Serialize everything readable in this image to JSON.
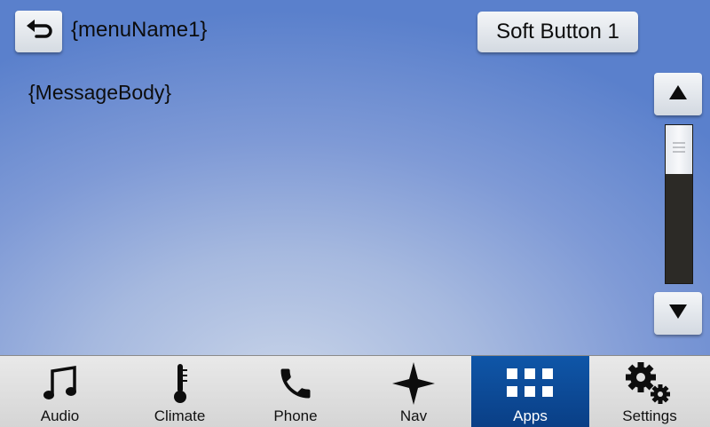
{
  "header": {
    "back_icon": "back-arrow-icon",
    "menu_name": "{menuName1}",
    "soft_button_label": "Soft Button 1"
  },
  "content": {
    "message_body": "{MessageBody}"
  },
  "scrollbar": {
    "up_icon": "triangle-up-icon",
    "down_icon": "triangle-down-icon",
    "position": 0
  },
  "nav": {
    "active_color": "#0d4d9c",
    "items": [
      {
        "label": "Audio",
        "icon": "music-note-icon"
      },
      {
        "label": "Climate",
        "icon": "thermometer-icon"
      },
      {
        "label": "Phone",
        "icon": "phone-icon"
      },
      {
        "label": "Nav",
        "icon": "compass-star-icon"
      },
      {
        "label": "Apps",
        "icon": "apps-grid-icon",
        "active": true
      },
      {
        "label": "Settings",
        "icon": "gears-icon"
      }
    ]
  }
}
